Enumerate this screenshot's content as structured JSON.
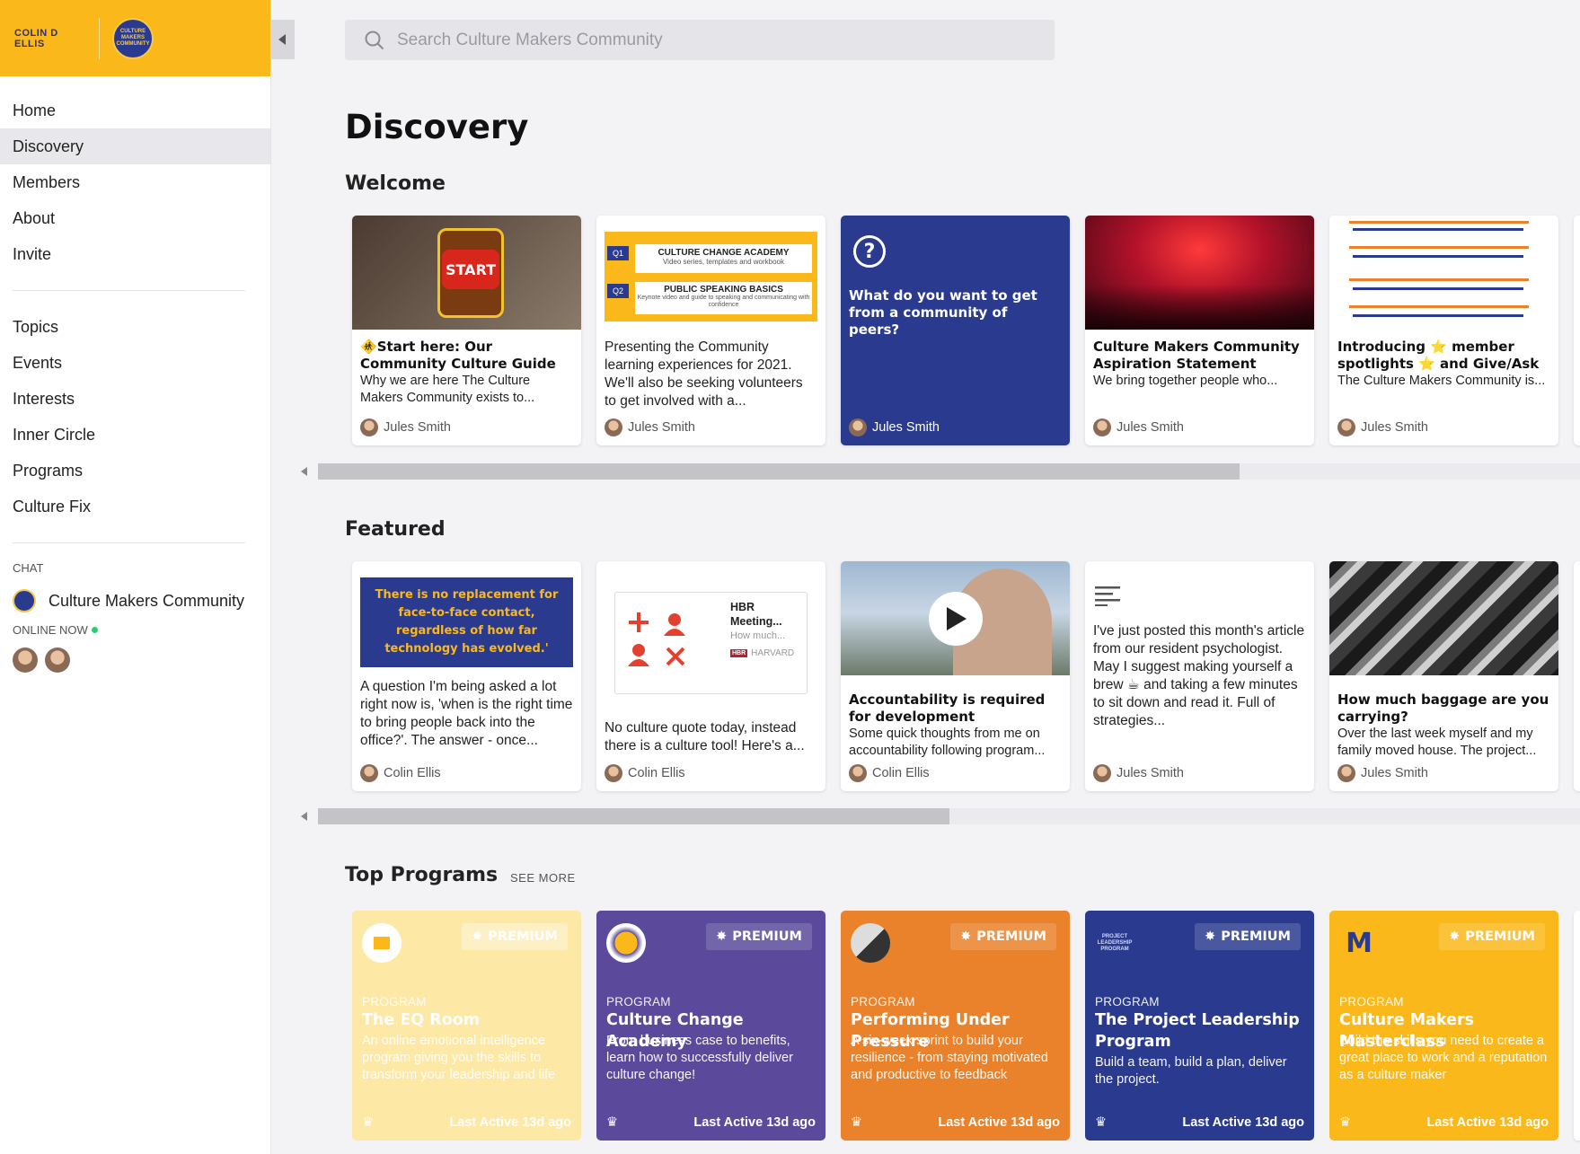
{
  "brand": {
    "logo_text": "COLIN D ELLIS",
    "badge_text": "CULTURE MAKERS COMMUNITY"
  },
  "nav": {
    "primary": [
      "Home",
      "Discovery",
      "Members",
      "About",
      "Invite"
    ],
    "secondary": [
      "Topics",
      "Events",
      "Interests",
      "Inner Circle",
      "Programs",
      "Culture Fix"
    ],
    "active": "Discovery"
  },
  "chat": {
    "title": "CHAT",
    "room": "Culture Makers Community",
    "online_title": "ONLINE NOW"
  },
  "search": {
    "placeholder": "Search Culture Makers Community"
  },
  "page_title": "Discovery",
  "sections": {
    "welcome": "Welcome",
    "featured": "Featured",
    "top_programs": "Top Programs",
    "see_more": "SEE MORE"
  },
  "welcome_cards": [
    {
      "title": "Start here: Our Community Culture Guide",
      "excerpt": "Why we are here The Culture Makers Community exists to...",
      "author": "Jules Smith",
      "thumb_text": "START"
    },
    {
      "excerpt": "Presenting the Community learning experiences for 2021. We'll also be seeking volunteers to get involved with a...",
      "author": "Jules Smith",
      "thumb_lines": [
        "CULTURE CHANGE ACADEMY",
        "Video series, templates and workbook",
        "PUBLIC SPEAKING BASICS",
        "Keynote video and guide to speaking and communicating with confidence"
      ],
      "thumb_tags": [
        "Q1",
        "Q2"
      ]
    },
    {
      "question": "What do you want to get from a community of peers?",
      "author": "Jules Smith"
    },
    {
      "title": "Culture Makers Community Aspiration Statement",
      "excerpt": "We bring together people who...",
      "author": "Jules Smith"
    },
    {
      "title": "Introducing ⭐ member spotlights ⭐ and Give/Ask",
      "excerpt": "The Culture Makers Community is...",
      "author": "Jules Smith"
    }
  ],
  "featured_cards": [
    {
      "quote": "There is no replacement for face-to-face contact, regardless of how far technology has evolved.'",
      "text": "A question I'm being asked a lot right now is, 'when is the right time to bring people back into the office?'. The answer - once...",
      "author": "Colin Ellis"
    },
    {
      "link_title": "HBR Meeting...",
      "link_sub": "How much...",
      "link_source": "HARVARD",
      "link_source_short": "HBR",
      "text": "No culture quote today, instead there is a culture tool! Here's a...",
      "author": "Colin Ellis"
    },
    {
      "title": "Accountability is required for development",
      "excerpt": "Some quick thoughts from me on accountability following program...",
      "author": "Colin Ellis"
    },
    {
      "text": "I've just posted this month's article from our resident psychologist. May I suggest making yourself a brew ☕ and taking a few minutes to sit down and read it. Full of strategies...",
      "author": "Jules Smith"
    },
    {
      "title": "How much baggage are you carrying?",
      "excerpt": "Over the last week myself and my family moved house. The project...",
      "author": "Jules Smith"
    }
  ],
  "programs": [
    {
      "kind": "PROGRAM",
      "badge": "PREMIUM",
      "title": "The EQ Room",
      "desc": "An online emotional intelligence program giving you the skills to transform your leadership and life",
      "active": "Last Active 13d ago"
    },
    {
      "kind": "PROGRAM",
      "badge": "PREMIUM",
      "title": "Culture Change Academy",
      "desc": "From business case to benefits, learn how to successfully deliver culture change!",
      "active": "Last Active 13d ago"
    },
    {
      "kind": "PROGRAM",
      "badge": "PREMIUM",
      "title": "Performing Under Pressure",
      "desc": "A six-week sprint to build your resilience - from staying motivated and productive to feedback",
      "active": "Last Active 13d ago"
    },
    {
      "kind": "PROGRAM",
      "badge": "PREMIUM",
      "title": "The Project Leadership Program",
      "desc": "Build a team, build a plan, deliver the project.",
      "active": "Last Active 13d ago",
      "logo_text": "PROJECT LEADERSHIP PROGRAM"
    },
    {
      "kind": "PROGRAM",
      "badge": "PREMIUM",
      "title": "Culture Makers Masterclass",
      "desc": "Build the skills you need to create a great place to work and a reputation as a culture maker",
      "active": "Last Active 13d ago",
      "logo_text": "M"
    }
  ],
  "colors": {
    "brand_yellow": "#fbb81a",
    "navy": "#2a3b8f",
    "purple": "#5b4a9b",
    "orange": "#e9822a",
    "online_green": "#2ecc71"
  },
  "scroll": {
    "welcome_position": 0.0,
    "welcome_visible_fraction": 0.73,
    "featured_position": 0.0,
    "featured_visible_fraction": 0.5
  }
}
